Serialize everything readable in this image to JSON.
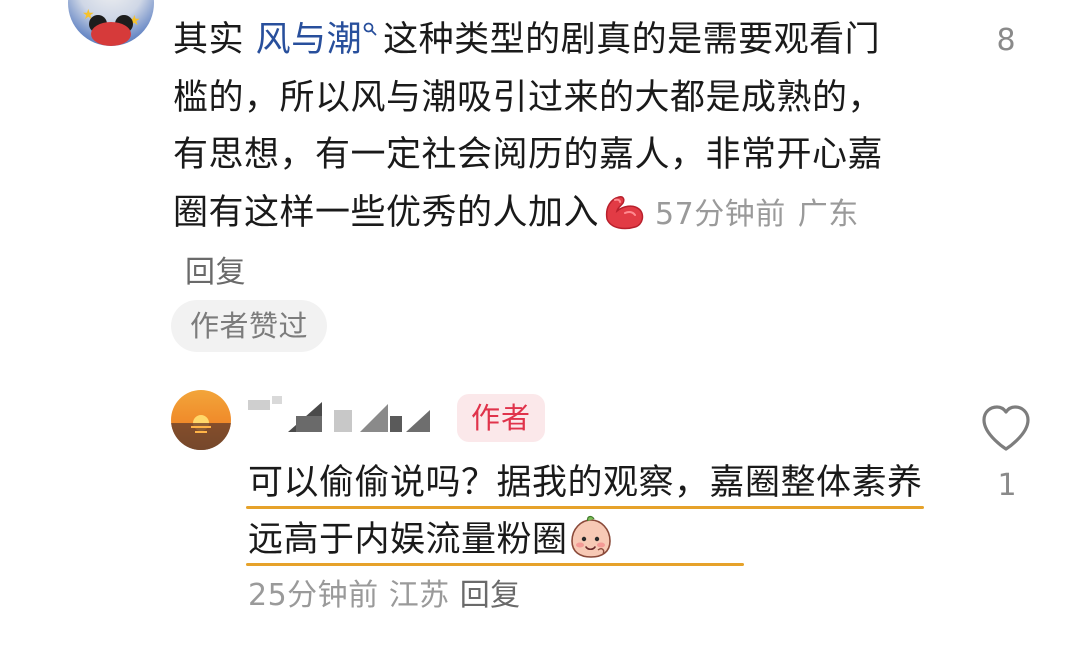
{
  "comment": {
    "text_prefix": "其实 ",
    "keyword": "风与潮",
    "keyword_icon": "search-icon",
    "text_body": "这种类型的剧真的是需要观看门槛的，所以风与潮吸引过来的大都是成熟的，有思想，有一定社会阅历的嘉人，非常开心嘉圈有这样一些优秀的人加入",
    "emoji": "flexed-biceps-emoji",
    "time": "57分钟前",
    "location": "广东",
    "reply_label": "回复",
    "liked_by_author": "作者赞过",
    "like_count": "8",
    "like_icon": "heart-outline-icon"
  },
  "reply": {
    "author_badge": "作者",
    "text": "可以偷偷说吗？据我的观察，嘉圈整体素养远高于内娱流量粉圈",
    "emoji": "peach-face-emoji",
    "time": "25分钟前",
    "location": "江苏",
    "reply_label": "回复",
    "like_count": "1",
    "like_icon": "heart-outline-icon",
    "underline_color": "#e6a22a"
  },
  "colors": {
    "keyword": "#284f9c",
    "meta": "#9a9a9a",
    "badge_text": "#e0334b",
    "badge_bg": "#fbe8ea"
  }
}
